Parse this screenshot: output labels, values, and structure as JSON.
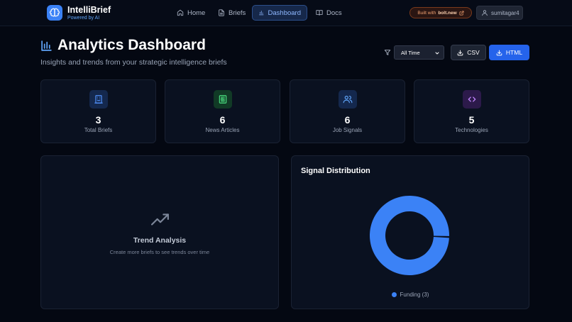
{
  "nav": {
    "brand": "IntelliBrief",
    "brand_sub": "Powered by AI",
    "links": [
      {
        "label": "Home",
        "icon": "home-icon"
      },
      {
        "label": "Briefs",
        "icon": "file-icon"
      },
      {
        "label": "Dashboard",
        "icon": "bar-chart-icon",
        "active": true
      },
      {
        "label": "Docs",
        "icon": "book-icon"
      }
    ],
    "built_with": "Built with",
    "built_with_brand": "bolt.new",
    "username": "sumitagar4"
  },
  "header": {
    "title": "Analytics Dashboard",
    "subtitle": "Insights and trends from your strategic intelligence briefs",
    "time_filter": "All Time",
    "csv_label": "CSV",
    "html_label": "HTML"
  },
  "stats": [
    {
      "value": "3",
      "label": "Total Briefs",
      "icon": "building-icon",
      "color": "#4f8ff7",
      "bg": "#14284d"
    },
    {
      "value": "6",
      "label": "News Articles",
      "icon": "newspaper-icon",
      "color": "#4ade80",
      "bg": "#113a26"
    },
    {
      "value": "6",
      "label": "Job Signals",
      "icon": "users-icon",
      "color": "#60a5fa",
      "bg": "#14284d"
    },
    {
      "value": "5",
      "label": "Technologies",
      "icon": "code-icon",
      "color": "#c084fc",
      "bg": "#2c1a4a"
    }
  ],
  "trend": {
    "title": "Trend Analysis",
    "subtitle": "Create more briefs to see trends over time"
  },
  "distribution": {
    "title": "Signal Distribution",
    "legend": "Funding (3)"
  },
  "chart_data": {
    "type": "pie",
    "labels": [
      "Funding"
    ],
    "values": [
      3
    ],
    "colors": [
      "#3b82f6"
    ]
  },
  "colors": {
    "accent": "#3b82f6",
    "background": "#040812",
    "card": "#0a1120"
  }
}
